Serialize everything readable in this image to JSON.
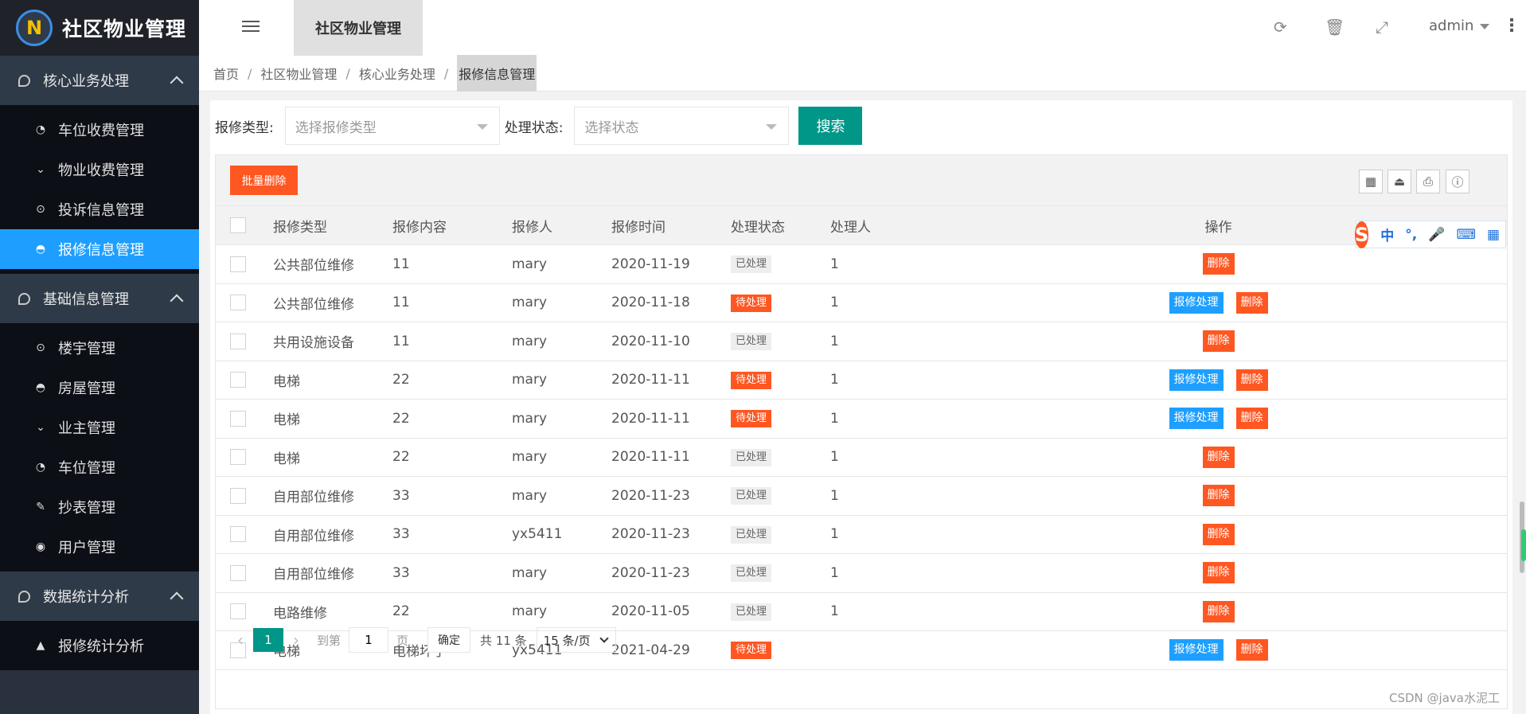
{
  "app": {
    "title": "社区物业管理",
    "logo_glyph": "N"
  },
  "header": {
    "active_tab": "社区物业管理",
    "user": "admin",
    "icons": [
      "refresh-icon",
      "trash-icon",
      "fullscreen-icon",
      "more-vertical-icon"
    ]
  },
  "sidebar": {
    "groups": [
      {
        "label": "核心业务处理",
        "items": [
          {
            "label": "车位收费管理",
            "icon": "dashboard-icon"
          },
          {
            "label": "物业收费管理",
            "icon": "chevrons-down-icon"
          },
          {
            "label": "投诉信息管理",
            "icon": "target-icon"
          },
          {
            "label": "报修信息管理",
            "icon": "compass-icon",
            "active": true
          }
        ]
      },
      {
        "label": "基础信息管理",
        "items": [
          {
            "label": "楼宇管理",
            "icon": "target-icon"
          },
          {
            "label": "房屋管理",
            "icon": "compass-icon"
          },
          {
            "label": "业主管理",
            "icon": "chevrons-down-icon"
          },
          {
            "label": "车位管理",
            "icon": "dashboard-icon"
          },
          {
            "label": "抄表管理",
            "icon": "edit-icon"
          },
          {
            "label": "用户管理",
            "icon": "user-icon"
          }
        ]
      },
      {
        "label": "数据统计分析",
        "items": [
          {
            "label": "报修统计分析",
            "icon": "chart-icon"
          }
        ]
      }
    ]
  },
  "breadcrumb": [
    "首页",
    "社区物业管理",
    "核心业务处理",
    "报修信息管理"
  ],
  "search": {
    "type_label": "报修类型:",
    "type_placeholder": "选择报修类型",
    "status_label": "处理状态:",
    "status_placeholder": "选择状态",
    "button": "搜索"
  },
  "toolbar": {
    "batch_delete": "批量删除",
    "icons": [
      "columns-icon",
      "export-icon",
      "print-icon",
      "info-icon"
    ]
  },
  "table": {
    "columns": [
      "报修类型",
      "报修内容",
      "报修人",
      "报修时间",
      "处理状态",
      "处理人",
      "操作"
    ],
    "rows": [
      {
        "type": "公共部位维修",
        "content": "11",
        "reporter": "mary",
        "time": "2020-11-19",
        "status": "已处理",
        "handler": "1"
      },
      {
        "type": "公共部位维修",
        "content": "11",
        "reporter": "mary",
        "time": "2020-11-18",
        "status": "待处理",
        "handler": "1"
      },
      {
        "type": "共用设施设备",
        "content": "11",
        "reporter": "mary",
        "time": "2020-11-10",
        "status": "已处理",
        "handler": "1"
      },
      {
        "type": "电梯",
        "content": "22",
        "reporter": "mary",
        "time": "2020-11-11",
        "status": "待处理",
        "handler": "1"
      },
      {
        "type": "电梯",
        "content": "22",
        "reporter": "mary",
        "time": "2020-11-11",
        "status": "待处理",
        "handler": "1"
      },
      {
        "type": "电梯",
        "content": "22",
        "reporter": "mary",
        "time": "2020-11-11",
        "status": "已处理",
        "handler": "1"
      },
      {
        "type": "自用部位维修",
        "content": "33",
        "reporter": "mary",
        "time": "2020-11-23",
        "status": "已处理",
        "handler": "1"
      },
      {
        "type": "自用部位维修",
        "content": "33",
        "reporter": "yx5411",
        "time": "2020-11-23",
        "status": "已处理",
        "handler": "1"
      },
      {
        "type": "自用部位维修",
        "content": "33",
        "reporter": "mary",
        "time": "2020-11-23",
        "status": "已处理",
        "handler": "1"
      },
      {
        "type": "电路维修",
        "content": "22",
        "reporter": "mary",
        "time": "2020-11-05",
        "status": "已处理",
        "handler": "1"
      },
      {
        "type": "电梯",
        "content": "电梯坏了",
        "reporter": "yx5411",
        "time": "2021-04-29",
        "status": "待处理",
        "handler": ""
      }
    ],
    "action_repair": "报修处理",
    "action_delete": "删除",
    "status_pending": "待处理"
  },
  "pager": {
    "current_page": "1",
    "goto_label": "到第",
    "page_input": "1",
    "page_unit": "页",
    "confirm": "确定",
    "total": "共 11 条",
    "page_size": "15 条/页"
  },
  "ime": {
    "logo": "S",
    "items": [
      "中",
      "°,",
      "🎤",
      "⌨",
      "▦"
    ]
  },
  "watermark": "CSDN @java水泥工",
  "colors": {
    "primary": "#009688",
    "danger": "#ff5722",
    "info": "#1e9fff",
    "sidebar": "#28313d"
  }
}
